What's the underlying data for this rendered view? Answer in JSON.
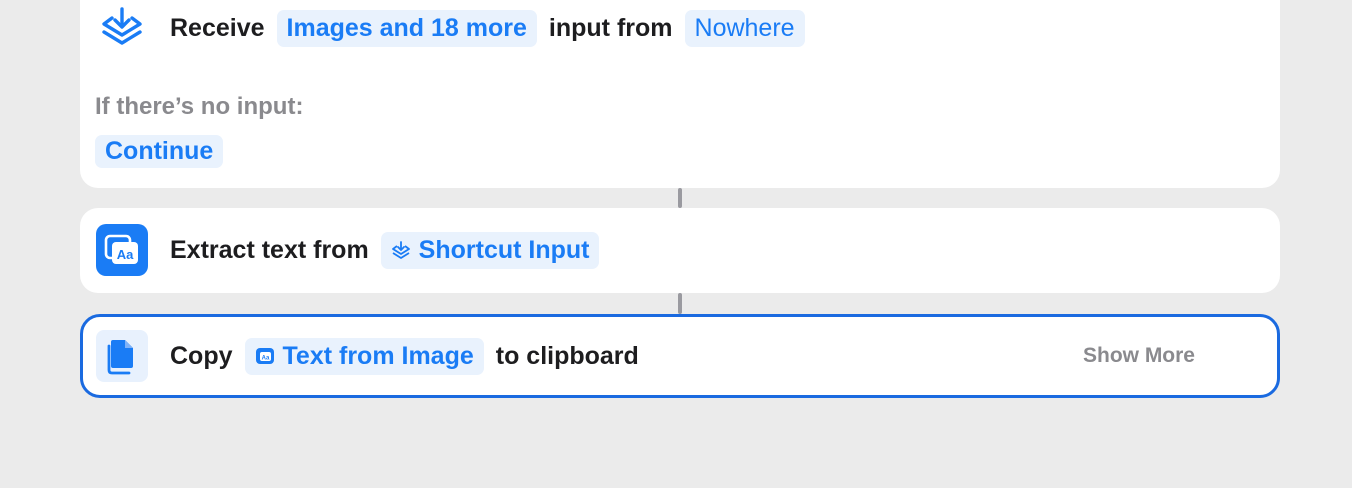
{
  "receive_action": {
    "verb": "Receive",
    "types_token": "Images and 18 more",
    "middle_text": "input from",
    "source_token": "Nowhere",
    "no_input_label": "If there’s no input:",
    "no_input_option": "Continue",
    "icon": "receive-tray-icon"
  },
  "extract_action": {
    "text": "Extract text from",
    "input_token": "Shortcut Input",
    "icon": "extract-text-from-image-icon",
    "token_icon": "shortcut-input-icon"
  },
  "copy_action": {
    "verb": "Copy",
    "input_token": "Text from Image",
    "tail_text": "to clipboard",
    "show_more": "Show More",
    "icon": "documents-icon",
    "token_icon": "text-from-image-icon"
  },
  "colors": {
    "accent": "#1a7cf5",
    "selection_border": "#1a6ae0",
    "background": "#ebebeb",
    "card": "#ffffff",
    "token_bg": "#e9f2fd",
    "secondary_text": "#8a8a8e"
  }
}
